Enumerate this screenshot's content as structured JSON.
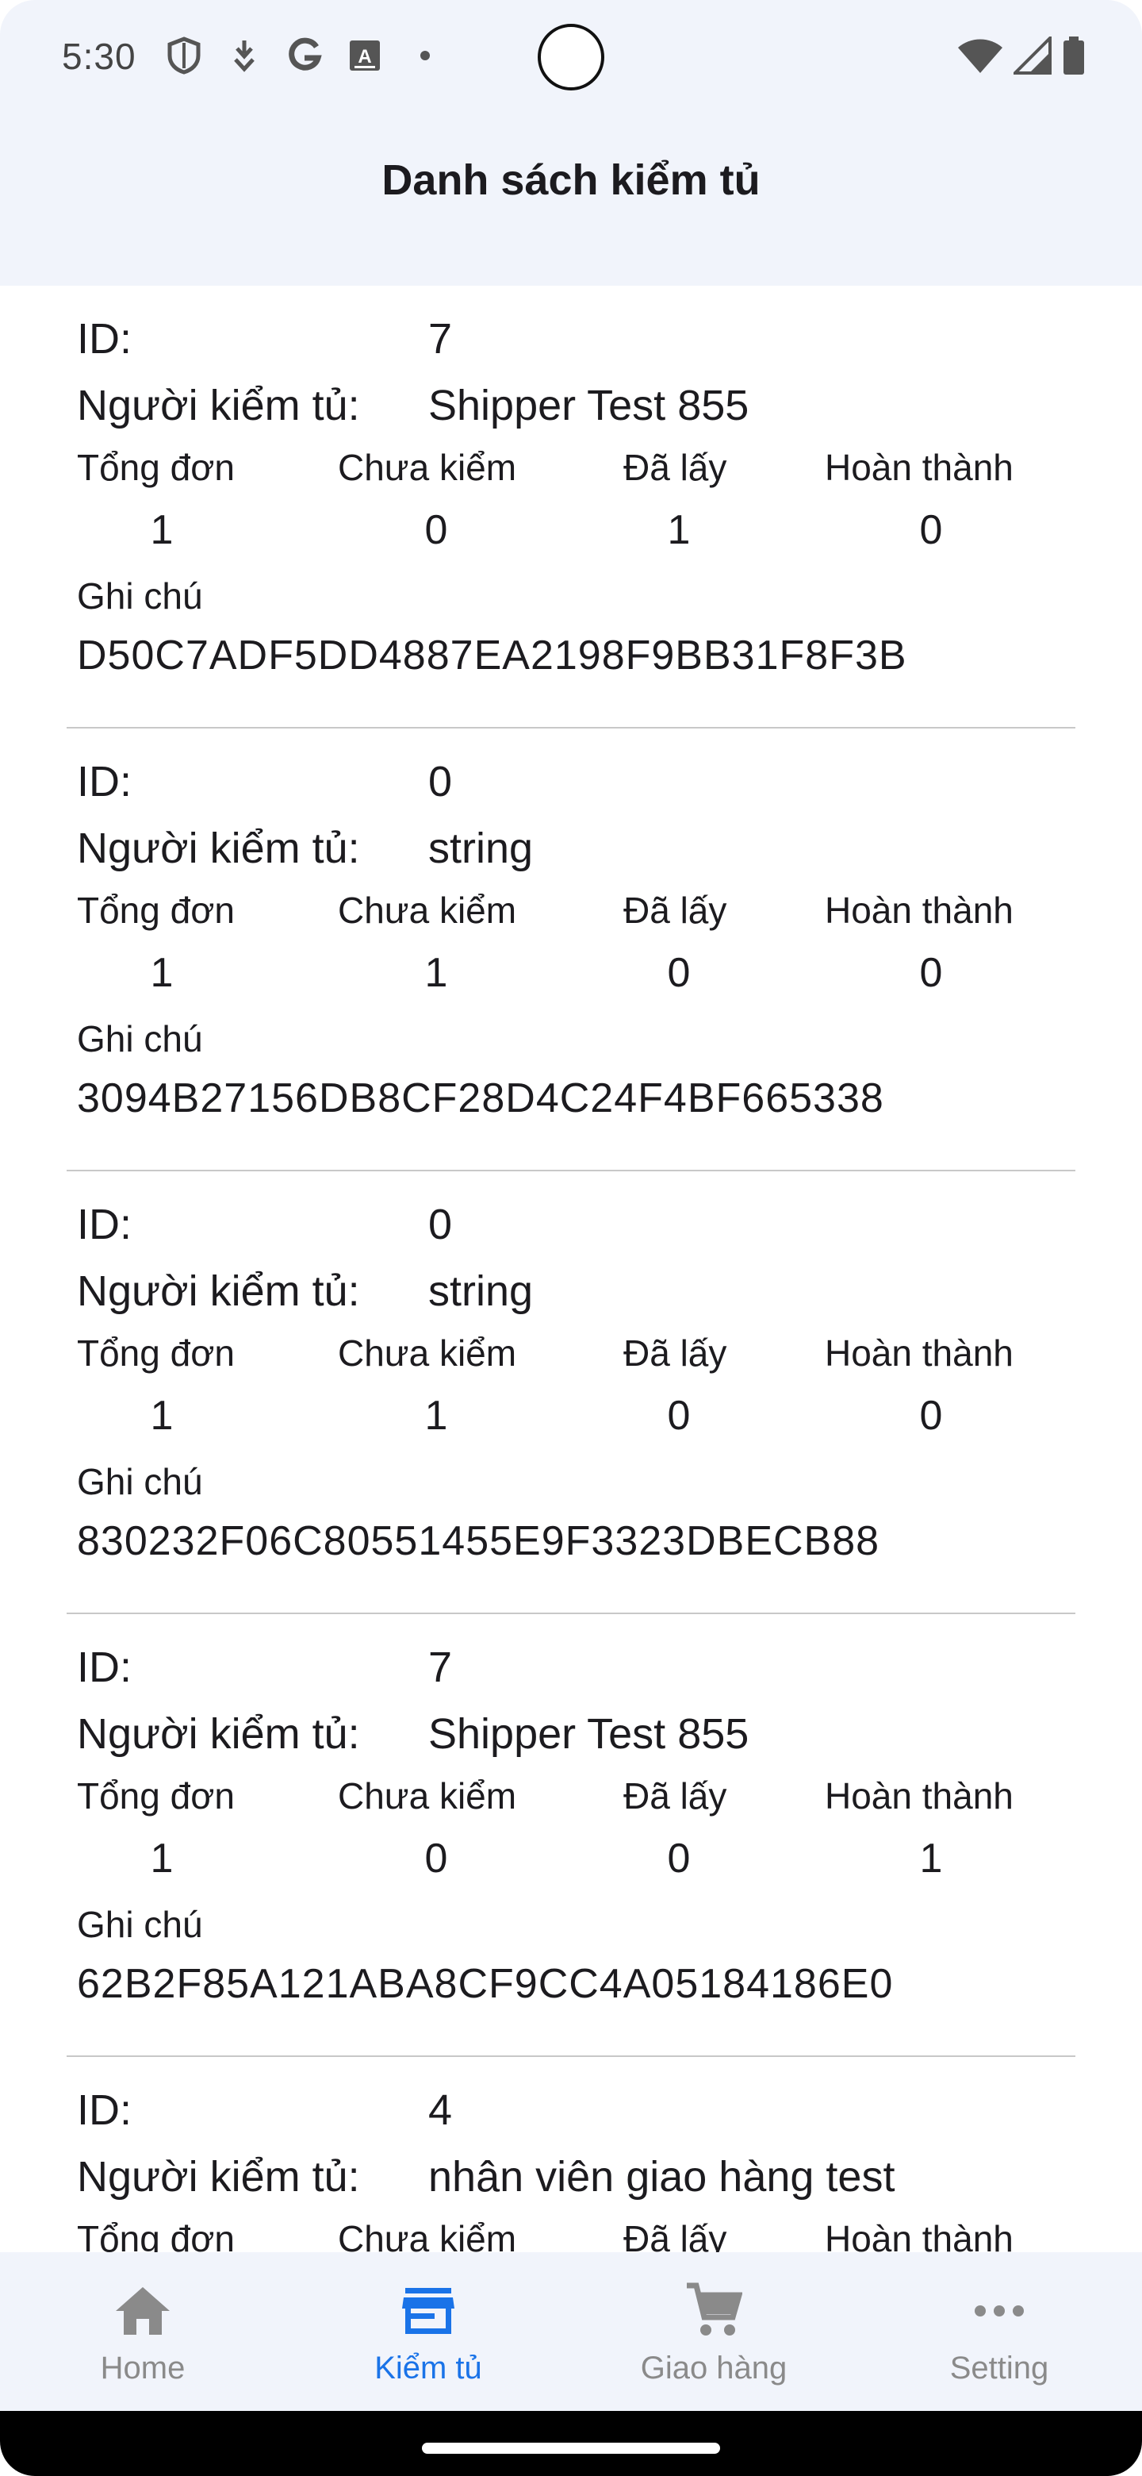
{
  "status_bar": {
    "time": "5:30",
    "left_icons": [
      "shield-icon",
      "usb-debug-icon",
      "google-icon",
      "keyboard-a-icon",
      "dot-icon"
    ],
    "right_icons": [
      "wifi-icon",
      "cellular-signal-icon",
      "battery-icon"
    ]
  },
  "app_bar": {
    "title": "Danh sách kiểm tủ"
  },
  "labels": {
    "id": "ID:",
    "checker": "Người kiểm tủ:",
    "total": "Tổng đơn",
    "unchecked": "Chưa kiểm",
    "picked": "Đã lấy",
    "done": "Hoàn thành",
    "note": "Ghi chú"
  },
  "records": [
    {
      "id": "7",
      "checker": "Shipper Test 855",
      "total": "1",
      "unchecked": "0",
      "picked": "1",
      "done": "0",
      "note": "D50C7ADF5DD4887EA2198F9BB31F8F3B"
    },
    {
      "id": "0",
      "checker": "string",
      "total": "1",
      "unchecked": "1",
      "picked": "0",
      "done": "0",
      "note": "3094B27156DB8CF28D4C24F4BF665338"
    },
    {
      "id": "0",
      "checker": "string",
      "total": "1",
      "unchecked": "1",
      "picked": "0",
      "done": "0",
      "note": "830232F06C80551455E9F3323DBECB88"
    },
    {
      "id": "7",
      "checker": "Shipper Test 855",
      "total": "1",
      "unchecked": "0",
      "picked": "0",
      "done": "1",
      "note": "62B2F85A121ABA8CF9CC4A05184186E0"
    },
    {
      "id": "4",
      "checker": "nhân viên giao hàng test",
      "total": "",
      "unchecked": "",
      "picked": "",
      "done": "",
      "note": ""
    }
  ],
  "bottom_nav": {
    "items": [
      {
        "label": "Home",
        "icon": "home-icon",
        "active": false
      },
      {
        "label": "Kiểm tủ",
        "icon": "store-icon",
        "active": true
      },
      {
        "label": "Giao hàng",
        "icon": "cart-icon",
        "active": false
      },
      {
        "label": "Setting",
        "icon": "more-icon",
        "active": false
      }
    ]
  },
  "colors": {
    "accent": "#1a73e8",
    "inactive": "#8a8a8a",
    "top_bg": "#f1f4fb",
    "divider": "#c8c8c8"
  }
}
